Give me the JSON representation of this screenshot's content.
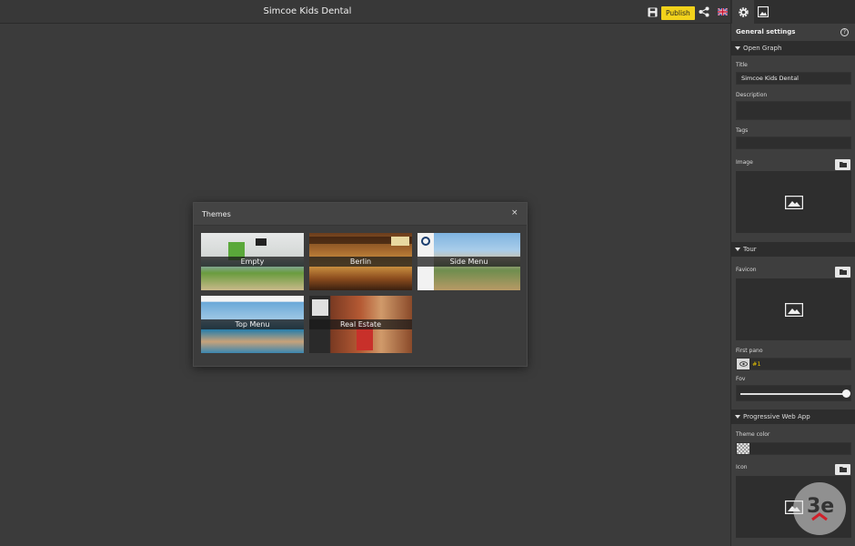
{
  "topbar": {
    "title": "Simcoe Kids Dental",
    "publish_label": "Publish",
    "icons": [
      "save-icon",
      "share-icon",
      "uk-flag-icon"
    ]
  },
  "panel": {
    "tabs": [
      "gear-icon",
      "image-icon"
    ],
    "heading": "General settings",
    "help_icon": "?",
    "sections": {
      "open_graph": "Open Graph",
      "tour": "Tour",
      "pwa": "Progressive Web App"
    },
    "fields": {
      "title_label": "Title",
      "title_value": "Simcoe Kids Dental",
      "description_label": "Description",
      "description_value": "",
      "tags_label": "Tags",
      "tags_value": "",
      "image_label": "Image",
      "favicon_label": "Favicon",
      "first_pano_label": "First pano",
      "first_pano_value": "#1",
      "fov_label": "Fov",
      "fov_level": 1.0,
      "theme_color_label": "Theme color",
      "icon_label": "Icon"
    }
  },
  "modal": {
    "title": "Themes",
    "close": "×",
    "themes": [
      {
        "name": "Empty"
      },
      {
        "name": "Berlin"
      },
      {
        "name": "Side Menu"
      },
      {
        "name": "Top Menu"
      },
      {
        "name": "Real Estate"
      }
    ]
  },
  "colors": {
    "accent": "#f2d21b",
    "background": "#3a3a3a",
    "panel": "#3e3e3e"
  }
}
